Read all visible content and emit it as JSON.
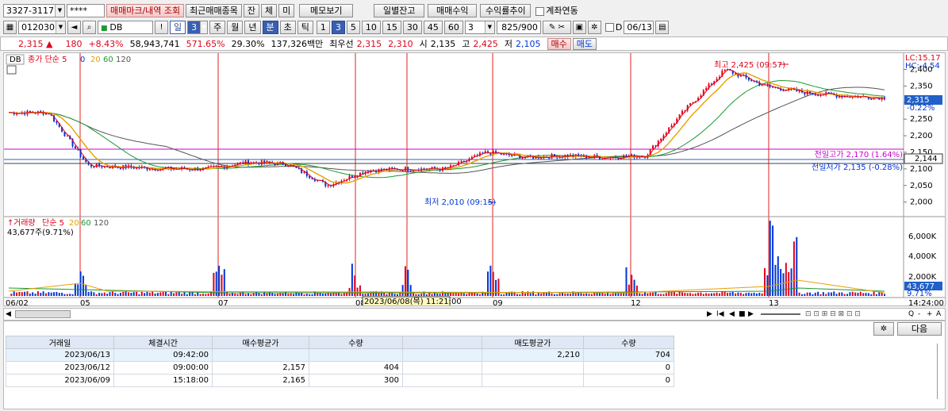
{
  "toolbar1": {
    "account": "3327-3117",
    "password": "****",
    "tab_mark": "매매마크/내역 조회",
    "tab_recent": "최근매매종목",
    "tab_jan": "잔",
    "tab_che": "체",
    "tab_mi": "미",
    "memo_button": "메모보기",
    "daily_balance_button": "일별잔고",
    "trade_profit_button": "매매수익",
    "profit_trend_button": "수익률추이",
    "account_link_label": "계좌연동"
  },
  "toolbar2": {
    "code": "012030",
    "name": "DB",
    "period_day": "일",
    "period_num": "3",
    "period_week": "주",
    "period_month": "월",
    "period_year": "년",
    "period_min": "분",
    "period_sec": "초",
    "period_tick": "틱",
    "intervals": [
      "1",
      "3",
      "5",
      "10",
      "15",
      "30",
      "45",
      "60"
    ],
    "interval_input": "3",
    "count_display": "825/900",
    "d_label": "D",
    "date_value": "06/13"
  },
  "quote": {
    "price": "2,315",
    "arrow": "▲",
    "change": "180",
    "change_pct": "+8.43%",
    "volume": "58,943,741",
    "vol_rate": "571.65%",
    "turnover": "29.30%",
    "amount": "137,326백만",
    "best_label": "최우선",
    "best_ask": "2,315",
    "best_bid": "2,310",
    "open_label": "시",
    "open": "2,135",
    "high_label": "고",
    "high": "2,425",
    "low_label": "저",
    "low": "2,105",
    "buy_button": "매수",
    "sell_button": "매도"
  },
  "price_panel": {
    "db_tag": "DB",
    "indicator_label": "종가 단순 5",
    "ma_legend": [
      "0",
      "20",
      "60",
      "120"
    ],
    "lc": "LC:15.17",
    "hc": "HC:-4.54",
    "current_price_tag": "2,315",
    "current_pct_tag": "-0.22%",
    "prev_close_tag": "2,144",
    "high_annotation": "최고 2,425 (09:57)",
    "low_annotation": "최저 2,010 (09:15)",
    "prev_high_label": "전일고가 2,170 (1.64%)",
    "prev_low_label": "전일저가 2,135 (-0.28%)",
    "y_ticks": [
      "2,400",
      "2,350",
      "2,300",
      "2,250",
      "2,200",
      "2,150",
      "2,100",
      "2,050",
      "2,000"
    ]
  },
  "volume_panel": {
    "title_vol": "거래량",
    "title_ma": "단순 5",
    "ma_legend": [
      "20",
      "60",
      "120"
    ],
    "info": "43,677주(9.71%)",
    "y_ticks": [
      "6,000K",
      "4,000K",
      "2,000K"
    ],
    "last_volume_tag": "43,677",
    "last_pct_tag": "9.71%"
  },
  "x_axis": {
    "labels": [
      "06/02",
      "05",
      "07",
      "08",
      "09",
      "12",
      "13"
    ],
    "cursor_label": "2023/06/08(목) 11:21:00",
    "end_time": "14:24:00"
  },
  "nav": {
    "next_button": "다음",
    "scroll_symbols": [
      "◀",
      "▶",
      "I◀",
      "◀",
      "■",
      "▶",
      "Q",
      "-",
      "+",
      "A"
    ]
  },
  "table": {
    "headers": [
      "거래일",
      "체결시간",
      "매수평균가",
      "수량",
      "",
      "매도평균가",
      "수량"
    ],
    "rows": [
      [
        "2023/06/13",
        "09:42:00",
        "",
        "",
        "",
        "2,210",
        "704"
      ],
      [
        "2023/06/12",
        "09:00:00",
        "2,157",
        "404",
        "",
        "",
        "0"
      ],
      [
        "2023/06/09",
        "15:18:00",
        "2,165",
        "300",
        "",
        "",
        "0"
      ]
    ]
  },
  "colors": {
    "up": "#e0001a",
    "down": "#0036d8",
    "ma5": "#e0001a",
    "ma20": "#e8a000",
    "ma60": "#1a9a30",
    "ma120": "#555555",
    "prev_line": "#cc00cc",
    "day_line": "#e02020"
  },
  "chart_data": {
    "type": "line",
    "x_days": [
      "06/02",
      "06/05",
      "06/07",
      "06/08",
      "06/09",
      "06/12",
      "06/13"
    ],
    "series": [
      {
        "name": "종가",
        "values": [
          2270,
          2270,
          2110,
          2105,
          2100,
          2100,
          2120,
          2115,
          2050,
          2095,
          2100,
          2100,
          2150,
          2135,
          2140,
          2135,
          2140,
          2280,
          2400,
          2350,
          2330,
          2320,
          2315
        ]
      }
    ],
    "ylim": [
      1980,
      2430
    ]
  }
}
